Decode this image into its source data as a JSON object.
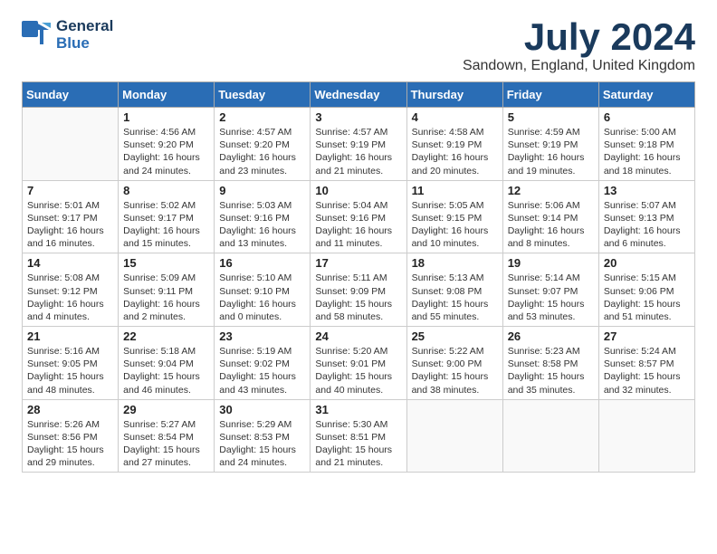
{
  "header": {
    "logo_general": "General",
    "logo_blue": "Blue",
    "title": "July 2024",
    "location": "Sandown, England, United Kingdom"
  },
  "weekdays": [
    "Sunday",
    "Monday",
    "Tuesday",
    "Wednesday",
    "Thursday",
    "Friday",
    "Saturday"
  ],
  "weeks": [
    [
      {
        "day": "",
        "sunrise": "",
        "sunset": "",
        "daylight": ""
      },
      {
        "day": "1",
        "sunrise": "Sunrise: 4:56 AM",
        "sunset": "Sunset: 9:20 PM",
        "daylight": "Daylight: 16 hours and 24 minutes."
      },
      {
        "day": "2",
        "sunrise": "Sunrise: 4:57 AM",
        "sunset": "Sunset: 9:20 PM",
        "daylight": "Daylight: 16 hours and 23 minutes."
      },
      {
        "day": "3",
        "sunrise": "Sunrise: 4:57 AM",
        "sunset": "Sunset: 9:19 PM",
        "daylight": "Daylight: 16 hours and 21 minutes."
      },
      {
        "day": "4",
        "sunrise": "Sunrise: 4:58 AM",
        "sunset": "Sunset: 9:19 PM",
        "daylight": "Daylight: 16 hours and 20 minutes."
      },
      {
        "day": "5",
        "sunrise": "Sunrise: 4:59 AM",
        "sunset": "Sunset: 9:19 PM",
        "daylight": "Daylight: 16 hours and 19 minutes."
      },
      {
        "day": "6",
        "sunrise": "Sunrise: 5:00 AM",
        "sunset": "Sunset: 9:18 PM",
        "daylight": "Daylight: 16 hours and 18 minutes."
      }
    ],
    [
      {
        "day": "7",
        "sunrise": "Sunrise: 5:01 AM",
        "sunset": "Sunset: 9:17 PM",
        "daylight": "Daylight: 16 hours and 16 minutes."
      },
      {
        "day": "8",
        "sunrise": "Sunrise: 5:02 AM",
        "sunset": "Sunset: 9:17 PM",
        "daylight": "Daylight: 16 hours and 15 minutes."
      },
      {
        "day": "9",
        "sunrise": "Sunrise: 5:03 AM",
        "sunset": "Sunset: 9:16 PM",
        "daylight": "Daylight: 16 hours and 13 minutes."
      },
      {
        "day": "10",
        "sunrise": "Sunrise: 5:04 AM",
        "sunset": "Sunset: 9:16 PM",
        "daylight": "Daylight: 16 hours and 11 minutes."
      },
      {
        "day": "11",
        "sunrise": "Sunrise: 5:05 AM",
        "sunset": "Sunset: 9:15 PM",
        "daylight": "Daylight: 16 hours and 10 minutes."
      },
      {
        "day": "12",
        "sunrise": "Sunrise: 5:06 AM",
        "sunset": "Sunset: 9:14 PM",
        "daylight": "Daylight: 16 hours and 8 minutes."
      },
      {
        "day": "13",
        "sunrise": "Sunrise: 5:07 AM",
        "sunset": "Sunset: 9:13 PM",
        "daylight": "Daylight: 16 hours and 6 minutes."
      }
    ],
    [
      {
        "day": "14",
        "sunrise": "Sunrise: 5:08 AM",
        "sunset": "Sunset: 9:12 PM",
        "daylight": "Daylight: 16 hours and 4 minutes."
      },
      {
        "day": "15",
        "sunrise": "Sunrise: 5:09 AM",
        "sunset": "Sunset: 9:11 PM",
        "daylight": "Daylight: 16 hours and 2 minutes."
      },
      {
        "day": "16",
        "sunrise": "Sunrise: 5:10 AM",
        "sunset": "Sunset: 9:10 PM",
        "daylight": "Daylight: 16 hours and 0 minutes."
      },
      {
        "day": "17",
        "sunrise": "Sunrise: 5:11 AM",
        "sunset": "Sunset: 9:09 PM",
        "daylight": "Daylight: 15 hours and 58 minutes."
      },
      {
        "day": "18",
        "sunrise": "Sunrise: 5:13 AM",
        "sunset": "Sunset: 9:08 PM",
        "daylight": "Daylight: 15 hours and 55 minutes."
      },
      {
        "day": "19",
        "sunrise": "Sunrise: 5:14 AM",
        "sunset": "Sunset: 9:07 PM",
        "daylight": "Daylight: 15 hours and 53 minutes."
      },
      {
        "day": "20",
        "sunrise": "Sunrise: 5:15 AM",
        "sunset": "Sunset: 9:06 PM",
        "daylight": "Daylight: 15 hours and 51 minutes."
      }
    ],
    [
      {
        "day": "21",
        "sunrise": "Sunrise: 5:16 AM",
        "sunset": "Sunset: 9:05 PM",
        "daylight": "Daylight: 15 hours and 48 minutes."
      },
      {
        "day": "22",
        "sunrise": "Sunrise: 5:18 AM",
        "sunset": "Sunset: 9:04 PM",
        "daylight": "Daylight: 15 hours and 46 minutes."
      },
      {
        "day": "23",
        "sunrise": "Sunrise: 5:19 AM",
        "sunset": "Sunset: 9:02 PM",
        "daylight": "Daylight: 15 hours and 43 minutes."
      },
      {
        "day": "24",
        "sunrise": "Sunrise: 5:20 AM",
        "sunset": "Sunset: 9:01 PM",
        "daylight": "Daylight: 15 hours and 40 minutes."
      },
      {
        "day": "25",
        "sunrise": "Sunrise: 5:22 AM",
        "sunset": "Sunset: 9:00 PM",
        "daylight": "Daylight: 15 hours and 38 minutes."
      },
      {
        "day": "26",
        "sunrise": "Sunrise: 5:23 AM",
        "sunset": "Sunset: 8:58 PM",
        "daylight": "Daylight: 15 hours and 35 minutes."
      },
      {
        "day": "27",
        "sunrise": "Sunrise: 5:24 AM",
        "sunset": "Sunset: 8:57 PM",
        "daylight": "Daylight: 15 hours and 32 minutes."
      }
    ],
    [
      {
        "day": "28",
        "sunrise": "Sunrise: 5:26 AM",
        "sunset": "Sunset: 8:56 PM",
        "daylight": "Daylight: 15 hours and 29 minutes."
      },
      {
        "day": "29",
        "sunrise": "Sunrise: 5:27 AM",
        "sunset": "Sunset: 8:54 PM",
        "daylight": "Daylight: 15 hours and 27 minutes."
      },
      {
        "day": "30",
        "sunrise": "Sunrise: 5:29 AM",
        "sunset": "Sunset: 8:53 PM",
        "daylight": "Daylight: 15 hours and 24 minutes."
      },
      {
        "day": "31",
        "sunrise": "Sunrise: 5:30 AM",
        "sunset": "Sunset: 8:51 PM",
        "daylight": "Daylight: 15 hours and 21 minutes."
      },
      {
        "day": "",
        "sunrise": "",
        "sunset": "",
        "daylight": ""
      },
      {
        "day": "",
        "sunrise": "",
        "sunset": "",
        "daylight": ""
      },
      {
        "day": "",
        "sunrise": "",
        "sunset": "",
        "daylight": ""
      }
    ]
  ]
}
